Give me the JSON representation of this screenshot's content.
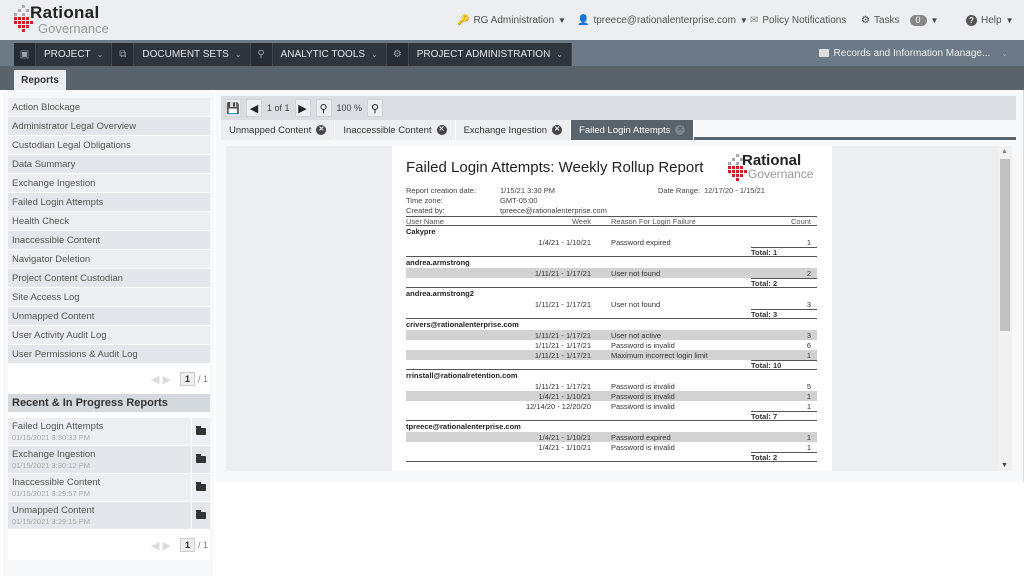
{
  "header": {
    "logo_top": "Rational",
    "logo_bottom": "Governance",
    "nav": [
      {
        "label": "RG Administration",
        "icon": "key-icon"
      },
      {
        "label": "tpreece@rationalenterprise.com",
        "icon": "user-icon"
      },
      {
        "label": "Policy Notifications",
        "icon": "envelope-icon"
      },
      {
        "label": "Tasks",
        "icon": "gear-icon",
        "badge": "0"
      },
      {
        "label": "Help",
        "icon": "question-icon"
      }
    ]
  },
  "menu": {
    "items": [
      {
        "label": "PROJECT",
        "icon": "briefcase-icon"
      },
      {
        "label": "DOCUMENT SETS",
        "icon": "documents-icon"
      },
      {
        "label": "ANALYTIC TOOLS",
        "icon": "search-icon"
      },
      {
        "label": "PROJECT ADMINISTRATION",
        "icon": "gear-icon"
      }
    ],
    "right": "Records and Information Manage...",
    "subtab": "Reports"
  },
  "sidebar": {
    "reports": [
      "Action Blockage",
      "Administrator Legal Overview",
      "Custodian Legal Obligations",
      "Data Summary",
      "Exchange Ingestion",
      "Failed Login Attempts",
      "Health Check",
      "Inaccessible Content",
      "Navigator Deletion",
      "Project Content Custodian",
      "Site Access Log",
      "Unmapped Content",
      "User Activity Audit Log",
      "User Permissions & Audit Log"
    ],
    "pager": {
      "page": "1",
      "total": "/ 1"
    },
    "recent_title": "Recent & In Progress Reports",
    "recent": [
      {
        "name": "Failed Login Attempts",
        "date": "01/15/2021 3:30:33 PM"
      },
      {
        "name": "Exchange Ingestion",
        "date": "01/15/2021 3:30:12 PM"
      },
      {
        "name": "Inaccessible Content",
        "date": "01/15/2021 3:29:57 PM"
      },
      {
        "name": "Unmapped Content",
        "date": "01/15/2021 3:29:15 PM"
      }
    ],
    "recent_pager": {
      "page": "1",
      "total": "/ 1"
    }
  },
  "toolbar": {
    "page_info": "1 of 1",
    "zoom": "100 %"
  },
  "tabs": [
    {
      "label": "Unmapped Content",
      "active": false
    },
    {
      "label": "Inaccessible Content",
      "active": false
    },
    {
      "label": "Exchange Ingestion",
      "active": false
    },
    {
      "label": "Failed Login Attempts",
      "active": true
    }
  ],
  "report": {
    "title": "Failed Login Attempts: Weekly Rollup Report",
    "creation_label": "Report creation date:",
    "creation_value": "1/15/21 3:30 PM",
    "tz_label": "Time zone:",
    "tz_value": "GMT-05:00",
    "created_label": "Created by:",
    "created_value": "tpreece@rationalenterprise.com",
    "range_label": "Date Range:",
    "range_value": "12/17/20 - 1/15/21",
    "columns": [
      "User Name",
      "Week",
      "Reason For Login Failure",
      "Count"
    ],
    "groups": [
      {
        "user": "Cakypre",
        "total": "Total: 1",
        "rows": [
          {
            "week": "1/4/21 - 1/10/21",
            "reason": "Password expired",
            "count": "1"
          }
        ]
      },
      {
        "user": "andrea.armstrong",
        "total": "Total: 2",
        "rows": [
          {
            "week": "1/11/21 - 1/17/21",
            "reason": "User not found",
            "count": "2"
          }
        ]
      },
      {
        "user": "andrea.armstrong2",
        "total": "Total: 3",
        "rows": [
          {
            "week": "1/11/21 - 1/17/21",
            "reason": "User not found",
            "count": "3"
          }
        ]
      },
      {
        "user": "crivers@rationalenterprise.com",
        "total": "Total: 10",
        "rows": [
          {
            "week": "1/11/21 - 1/17/21",
            "reason": "User not active",
            "count": "3"
          },
          {
            "week": "1/11/21 - 1/17/21",
            "reason": "Password is invalid",
            "count": "6"
          },
          {
            "week": "1/11/21 - 1/17/21",
            "reason": "Maximum incorrect login limit",
            "count": "1"
          }
        ]
      },
      {
        "user": "rrinstall@rationalretention.com",
        "total": "Total: 7",
        "rows": [
          {
            "week": "1/11/21 - 1/17/21",
            "reason": "Password is invalid",
            "count": "5"
          },
          {
            "week": "1/4/21 - 1/10/21",
            "reason": "Password is invalid",
            "count": "1"
          },
          {
            "week": "12/14/20 - 12/20/20",
            "reason": "Password is invalid",
            "count": "1"
          }
        ]
      },
      {
        "user": "tpreece@rationalenterprise.com",
        "total": "Total: 2",
        "rows": [
          {
            "week": "1/4/21 - 1/10/21",
            "reason": "Password expired",
            "count": "1"
          },
          {
            "week": "1/4/21 - 1/10/21",
            "reason": "Password is invalid",
            "count": "1"
          }
        ]
      }
    ]
  },
  "colors": {
    "nav_dark": "#2e353b",
    "nav_bar": "#6b7a86",
    "subbar": "#59636b",
    "logo_red": "#c8202f"
  }
}
